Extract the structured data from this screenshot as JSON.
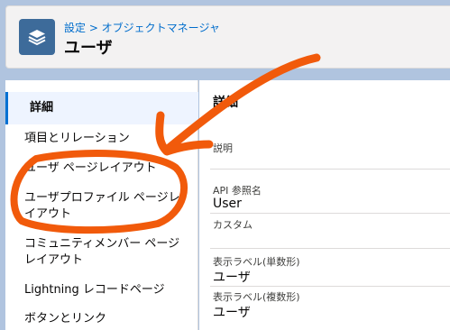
{
  "header": {
    "icon": "layers-icon",
    "breadcrumb": "設定 > オブジェクトマネージャ",
    "title": "ユーザ"
  },
  "sidebar": {
    "items": [
      {
        "label": "詳細",
        "active": true
      },
      {
        "label": "項目とリレーション"
      },
      {
        "label": "ユーザ ページレイアウト"
      },
      {
        "label": "ユーザプロファイル ページレ"
      },
      {
        "label": "イアウト"
      },
      {
        "label": "コミュニティメンバー ページ"
      },
      {
        "label": "レイアウト"
      },
      {
        "label": "Lightning レコードページ"
      },
      {
        "label": "ボタンとリンク"
      }
    ]
  },
  "main": {
    "title": "詳細",
    "fields": [
      {
        "label": "説明",
        "value": ""
      },
      {
        "label": "API 参照名",
        "value": "User"
      },
      {
        "label": "カスタム",
        "value": ""
      },
      {
        "label": "表示ラベル(単数形)",
        "value": "ユーザ"
      },
      {
        "label": "表示ラベル(複数形)",
        "value": "ユーザ"
      }
    ]
  },
  "colors": {
    "annotation": "#f15a0b",
    "accent": "#0070d2",
    "icon_bg": "#3d6b9a"
  }
}
